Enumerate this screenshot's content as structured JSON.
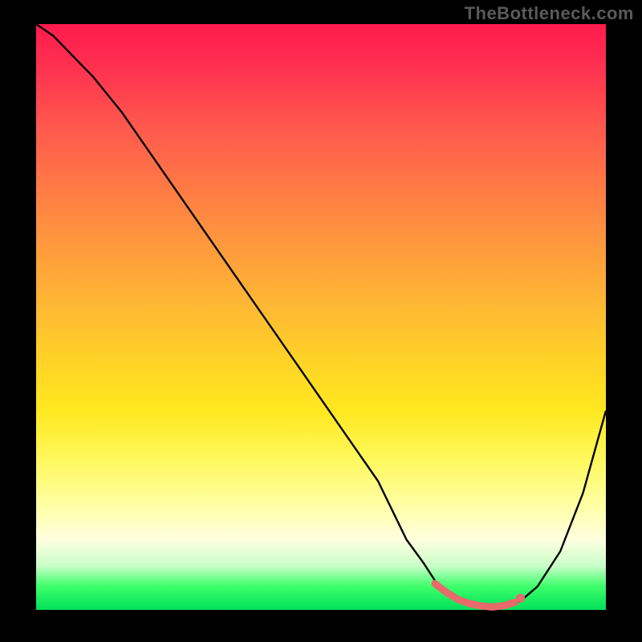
{
  "watermark": "TheBottleneck.com",
  "colors": {
    "curve": "#000000",
    "highlight": "#e86a6a",
    "gradient_top": "#ff1a4d",
    "gradient_bottom": "#00e05a"
  },
  "chart_data": {
    "type": "line",
    "title": "",
    "xlabel": "",
    "ylabel": "",
    "xlim": [
      0,
      100
    ],
    "ylim": [
      0,
      100
    ],
    "series": [
      {
        "name": "bottleneck-curve",
        "x": [
          0,
          3,
          6,
          10,
          15,
          20,
          25,
          30,
          35,
          40,
          45,
          50,
          55,
          60,
          63,
          65,
          68,
          70,
          73,
          76,
          78,
          80,
          82,
          85,
          88,
          92,
          96,
          100
        ],
        "y": [
          100,
          98,
          95,
          91,
          85,
          78,
          71,
          64,
          57,
          50,
          43,
          36,
          29,
          22,
          16,
          12,
          8,
          5,
          2.5,
          1.2,
          0.7,
          0.5,
          0.7,
          1.5,
          4,
          10,
          20,
          34
        ]
      }
    ],
    "highlight_region": {
      "name": "optimal-flat-region",
      "x": [
        70,
        72,
        74,
        76,
        78,
        80,
        82,
        84
      ],
      "y": [
        4.5,
        3.0,
        1.8,
        1.1,
        0.7,
        0.5,
        0.7,
        1.3
      ]
    },
    "marker": {
      "x": 85,
      "y": 2.0
    }
  }
}
